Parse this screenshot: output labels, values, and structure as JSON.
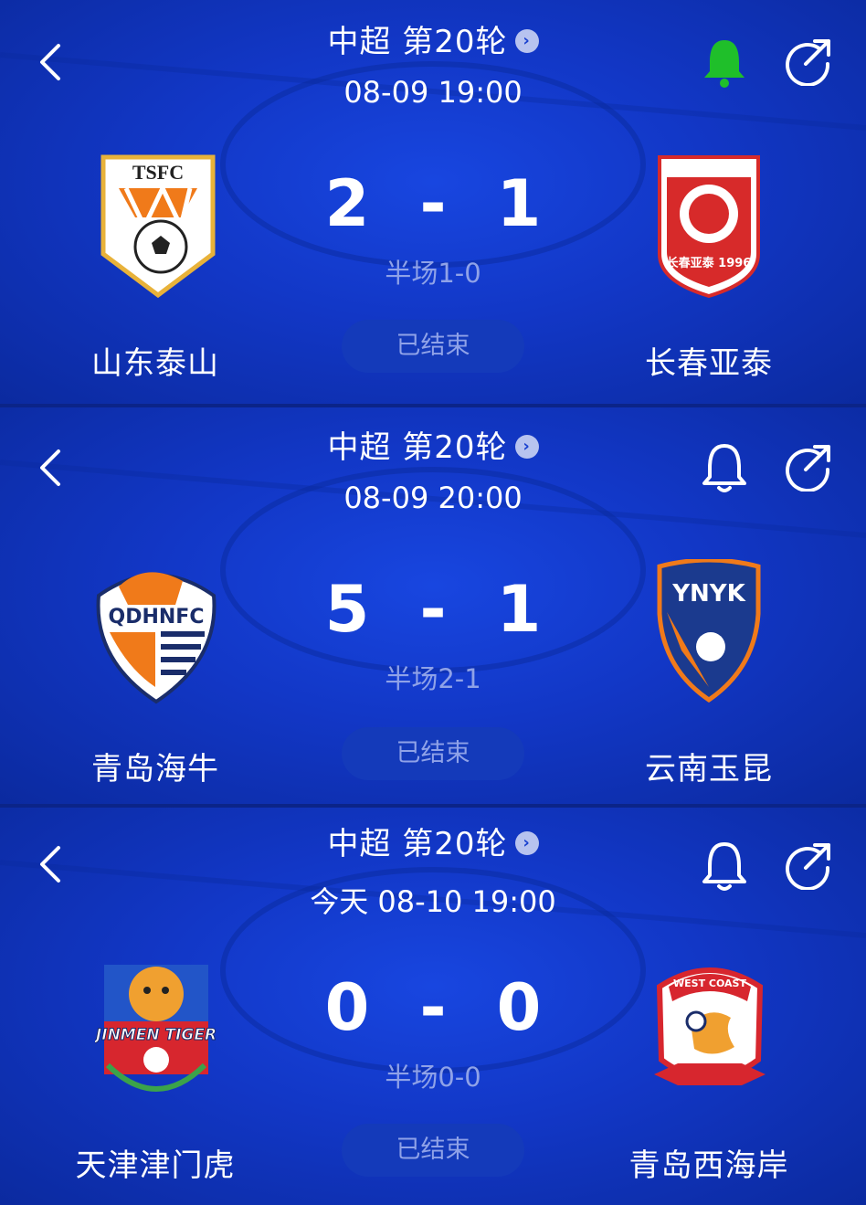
{
  "matches": [
    {
      "round": "中超 第20轮",
      "time": "08-09 19:00",
      "home_team": "山东泰山",
      "away_team": "长春亚泰",
      "home_score": "2",
      "away_score": "1",
      "separator": "-",
      "half_time": "半场1-0",
      "status": "已结束",
      "bell_active": true,
      "home_logo_text": "TSFC",
      "away_logo_text": "长春亚泰 1996"
    },
    {
      "round": "中超 第20轮",
      "time": "08-09 20:00",
      "home_team": "青岛海牛",
      "away_team": "云南玉昆",
      "home_score": "5",
      "away_score": "1",
      "separator": "-",
      "half_time": "半场2-1",
      "status": "已结束",
      "bell_active": false,
      "home_logo_text": "QDHNFC",
      "away_logo_text": "YNYK"
    },
    {
      "round": "中超 第20轮",
      "time": "今天 08-10 19:00",
      "home_team": "天津津门虎",
      "away_team": "青岛西海岸",
      "home_score": "0",
      "away_score": "0",
      "separator": "-",
      "half_time": "半场0-0",
      "status": "已结束",
      "bell_active": false,
      "home_logo_text": "JINMEN TIGER",
      "away_logo_text": "WEST COAST"
    }
  ],
  "colors": {
    "background": "#1237c6",
    "bell_active": "#1fbf2a",
    "muted_text": "#8fa2e8"
  },
  "icons": [
    "back-arrow-icon",
    "chevron-right-icon",
    "bell-icon",
    "share-icon"
  ]
}
